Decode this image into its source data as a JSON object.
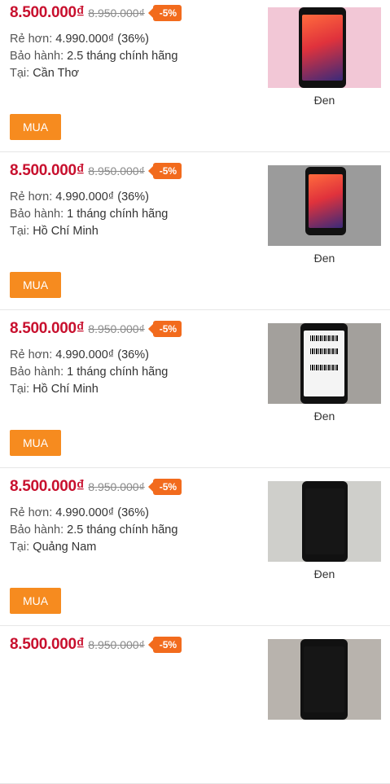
{
  "listings": [
    {
      "price": "8.500.000₫",
      "old_price": "8.950.000₫",
      "discount": "-5%",
      "saving_label": "Rẻ hơn:",
      "saving_value": "4.990.000₫ (36%)",
      "warranty_label": "Bảo hành:",
      "warranty_value": "2.5 tháng chính hãng",
      "location_label": "Tại:",
      "location_value": "Cần Thơ",
      "buy_label": "MUA",
      "color": "Đen"
    },
    {
      "price": "8.500.000₫",
      "old_price": "8.950.000₫",
      "discount": "-5%",
      "saving_label": "Rẻ hơn:",
      "saving_value": "4.990.000₫ (36%)",
      "warranty_label": "Bảo hành:",
      "warranty_value": "1 tháng chính hãng",
      "location_label": "Tại:",
      "location_value": "Hồ Chí Minh",
      "buy_label": "MUA",
      "color": "Đen"
    },
    {
      "price": "8.500.000₫",
      "old_price": "8.950.000₫",
      "discount": "-5%",
      "saving_label": "Rẻ hơn:",
      "saving_value": "4.990.000₫ (36%)",
      "warranty_label": "Bảo hành:",
      "warranty_value": "1 tháng chính hãng",
      "location_label": "Tại:",
      "location_value": "Hồ Chí Minh",
      "buy_label": "MUA",
      "color": "Đen"
    },
    {
      "price": "8.500.000₫",
      "old_price": "8.950.000₫",
      "discount": "-5%",
      "saving_label": "Rẻ hơn:",
      "saving_value": "4.990.000₫ (36%)",
      "warranty_label": "Bảo hành:",
      "warranty_value": "2.5 tháng chính hãng",
      "location_label": "Tại:",
      "location_value": "Quảng Nam",
      "buy_label": "MUA",
      "color": "Đen"
    },
    {
      "price": "8.500.000₫",
      "old_price": "8.950.000₫",
      "discount": "-5%"
    }
  ],
  "colors": {
    "price": "#c8102e",
    "badge": "#f26b1d",
    "buy_button": "#f68b1f"
  }
}
